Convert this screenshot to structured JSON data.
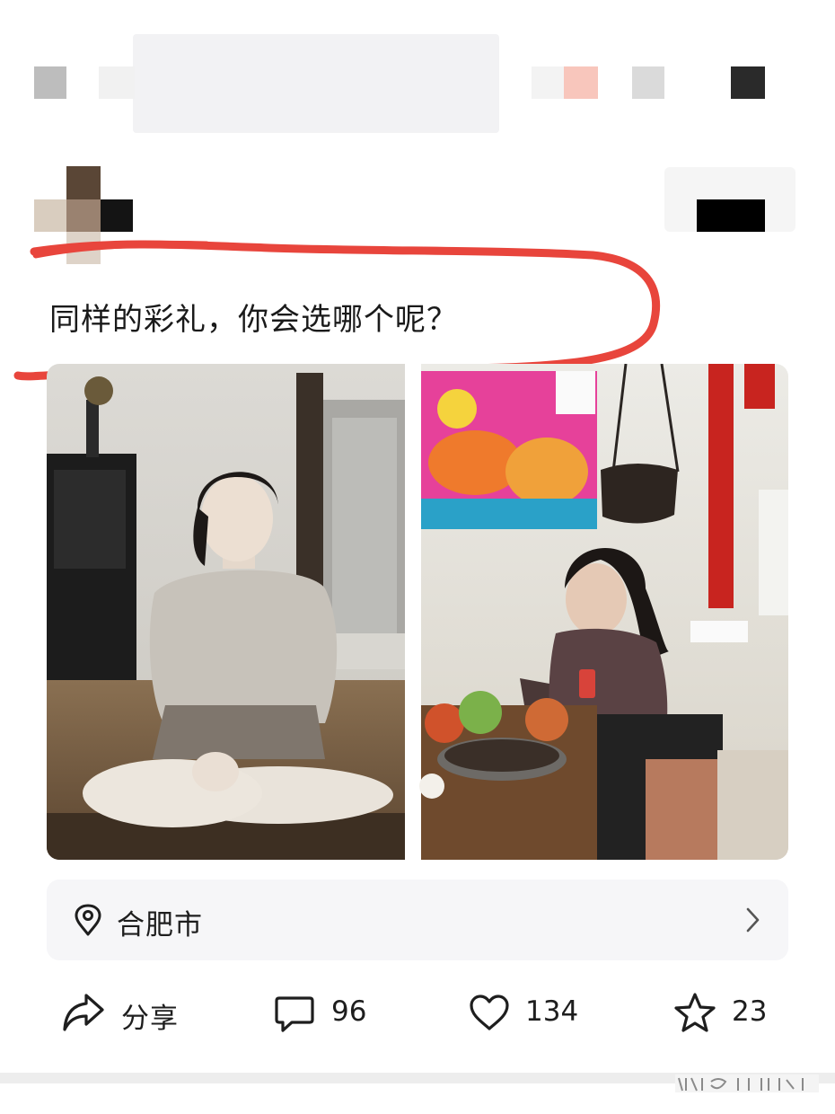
{
  "post": {
    "text": "同样的彩礼，你会选哪个呢？"
  },
  "location": {
    "label": "合肥市",
    "icon": "location-pin-icon",
    "chevron_icon": "chevron-right-icon"
  },
  "actions": {
    "share": {
      "label": "分享",
      "icon": "share-icon"
    },
    "comment": {
      "count": "96",
      "icon": "comment-icon"
    },
    "like": {
      "count": "134",
      "icon": "heart-icon"
    },
    "favorite": {
      "count": "23",
      "icon": "star-icon"
    }
  },
  "colors": {
    "annotation_red": "#e8453c",
    "location_bg": "#f6f6f8",
    "text": "#1e1e1e"
  }
}
